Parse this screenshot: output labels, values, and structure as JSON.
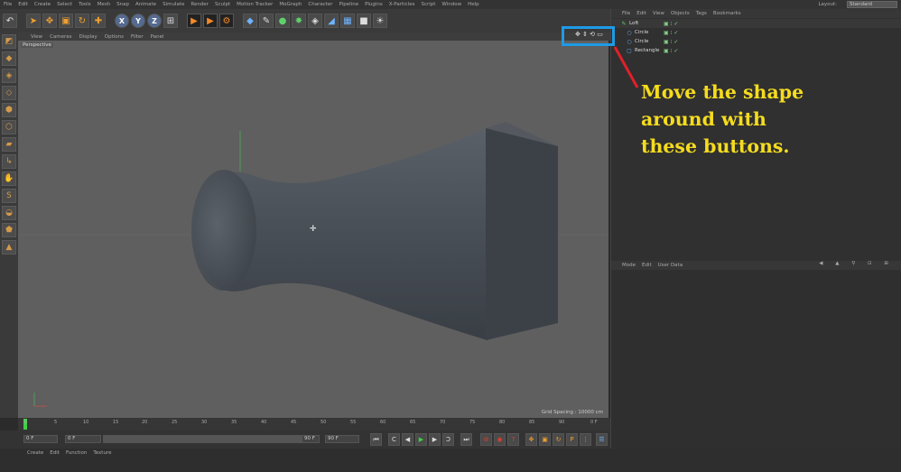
{
  "menubar": {
    "items": [
      "File",
      "Edit",
      "Create",
      "Select",
      "Tools",
      "Mesh",
      "Snap",
      "Animate",
      "Simulate",
      "Render",
      "Sculpt",
      "Motion Tracker",
      "MoGraph",
      "Character",
      "Pipeline",
      "Plugins",
      "X-Particles",
      "Script",
      "Window",
      "Help"
    ],
    "layout_label": "Layout:",
    "layout_value": "Standard"
  },
  "toolbar": {
    "undo_icon": "undo-icon",
    "axis_x": "X",
    "axis_y": "Y",
    "axis_z": "Z"
  },
  "viewport": {
    "menu": [
      "View",
      "Cameras",
      "Display",
      "Options",
      "Filter",
      "Panel"
    ],
    "camera_label": "Perspective",
    "grid_spacing": "Grid Spacing : 10000 cm",
    "nav_icons": "✥ ⇕ ⟲ ▭"
  },
  "timeline": {
    "ticks": [
      "0",
      "5",
      "10",
      "15",
      "20",
      "25",
      "30",
      "35",
      "40",
      "45",
      "50",
      "55",
      "60",
      "65",
      "70",
      "75",
      "80",
      "85",
      "90"
    ],
    "end_label": "0 F"
  },
  "playback": {
    "current_frame": "0 F",
    "start_frame": "0 F",
    "end_frame": "90 F",
    "max_frame": "90 F"
  },
  "material": {
    "menu": [
      "Create",
      "Edit",
      "Function",
      "Texture"
    ]
  },
  "object_manager": {
    "menu": [
      "File",
      "Edit",
      "View",
      "Objects",
      "Tags",
      "Bookmarks"
    ],
    "objects": [
      {
        "name": "Loft",
        "icon": "loft-icon",
        "indent": 0
      },
      {
        "name": "Circle",
        "icon": "circle-spline-icon",
        "indent": 1
      },
      {
        "name": "Circle",
        "icon": "circle-spline-icon",
        "indent": 1
      },
      {
        "name": "Rectangle",
        "icon": "rectangle-spline-icon",
        "indent": 1
      }
    ]
  },
  "attributes": {
    "menu": [
      "Mode",
      "Edit",
      "User Data"
    ]
  },
  "annotation": {
    "text_line1": "Move the shape",
    "text_line2": "around with",
    "text_line3": "these buttons.",
    "highlight_color": "#1e9be6",
    "arrow_color": "#e0202a",
    "text_color": "#f5dc1e"
  }
}
